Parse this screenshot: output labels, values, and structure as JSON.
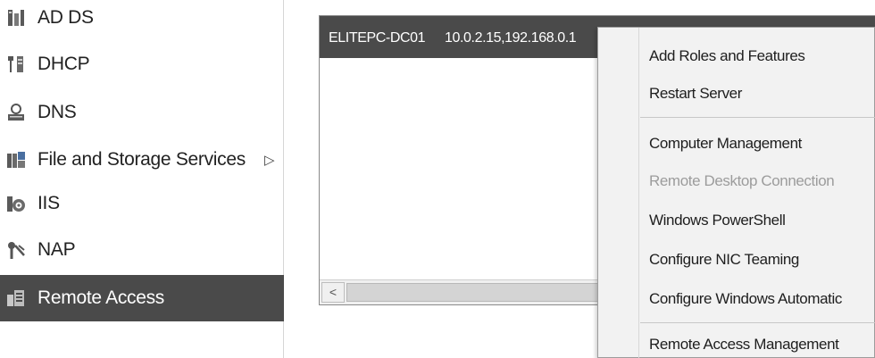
{
  "sidebar": {
    "items": [
      {
        "label": "AD DS",
        "icon": "ad-ds-icon"
      },
      {
        "label": "DHCP",
        "icon": "dhcp-icon"
      },
      {
        "label": "DNS",
        "icon": "dns-icon"
      },
      {
        "label": "File and Storage Services",
        "icon": "file-storage-icon",
        "has_submenu": true
      },
      {
        "label": "IIS",
        "icon": "iis-icon"
      },
      {
        "label": "NAP",
        "icon": "nap-icon"
      },
      {
        "label": "Remote Access",
        "icon": "remote-access-icon",
        "selected": true
      }
    ],
    "submenu_arrow": "▷"
  },
  "servers": {
    "rows": [
      {
        "name": "ELITEPC-DC01",
        "ip": "10.0.2.15,192.168.0.1"
      }
    ],
    "scroll_left": "<"
  },
  "context_menu": {
    "items": [
      {
        "label": "Add Roles and Features",
        "enabled": true
      },
      {
        "label": "Restart Server",
        "enabled": true
      },
      {
        "label": "Computer Management",
        "enabled": true
      },
      {
        "label": "Remote Desktop Connection",
        "enabled": false
      },
      {
        "label": "Windows PowerShell",
        "enabled": true
      },
      {
        "label": "Configure NIC Teaming",
        "enabled": true
      },
      {
        "label": "Configure Windows Automatic",
        "enabled": true
      },
      {
        "label": "Remote Access Management",
        "enabled": true
      }
    ]
  },
  "colors": {
    "selected_bg": "#4a4a4a",
    "selected_fg": "#ffffff",
    "disabled_text": "#9c9c9c",
    "menu_bg": "#f2f2f2"
  }
}
